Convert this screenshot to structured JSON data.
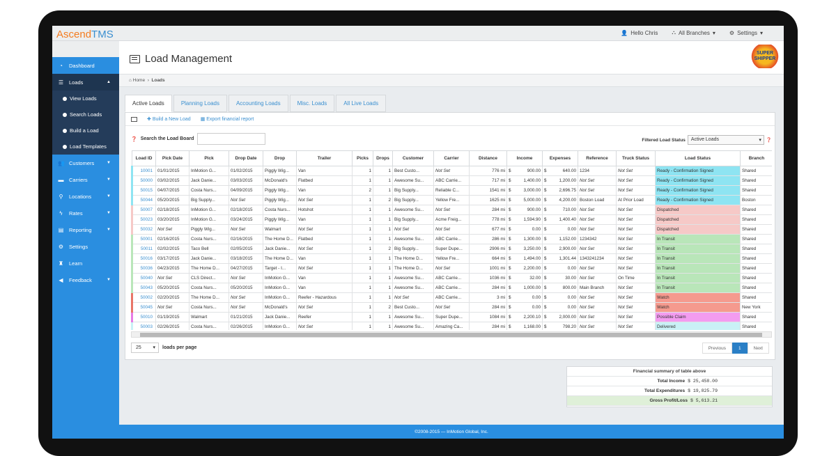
{
  "app": {
    "logo_a": "Ascend",
    "logo_b": "TMS"
  },
  "topnav": {
    "user": "Hello Chris",
    "branches": "All Branches",
    "settings": "Settings"
  },
  "sidebar": {
    "items": [
      {
        "label": "Dashboard",
        "icon": "dashboard-icon"
      },
      {
        "label": "Loads",
        "icon": "list-icon"
      },
      {
        "label": "Customers",
        "icon": "users-icon"
      },
      {
        "label": "Carriers",
        "icon": "truck-icon"
      },
      {
        "label": "Locations",
        "icon": "map-marker-icon"
      },
      {
        "label": "Rates",
        "icon": "bolt-icon"
      },
      {
        "label": "Reporting",
        "icon": "file-icon"
      },
      {
        "label": "Settings",
        "icon": "cogs-icon"
      },
      {
        "label": "Learn",
        "icon": "graduation-icon"
      },
      {
        "label": "Feedback",
        "icon": "bullhorn-icon"
      }
    ],
    "subitems": [
      "View Loads",
      "Search Loads",
      "Build a Load",
      "Load Templates"
    ]
  },
  "page": {
    "title": "Load Management",
    "breadcrumb_home": "Home",
    "breadcrumb_current": "Loads",
    "brand_logo": "SUPER SHIPPER"
  },
  "tabs": [
    "Active Loads",
    "Planning Loads",
    "Accounting Loads",
    "Misc. Loads",
    "All Live Loads"
  ],
  "toolbar": {
    "build": "Build a New Load",
    "export": "Export financial report"
  },
  "search": {
    "label": "Search the Load Board",
    "value": ""
  },
  "filter": {
    "label": "Filtered Load Status",
    "value": "Active Loads"
  },
  "table": {
    "headers": [
      "Load ID",
      "Pick Date",
      "Pick",
      "Drop Date",
      "Drop",
      "Trailer",
      "Picks",
      "Drops",
      "Customer",
      "Carrier",
      "Distance",
      "Income",
      "Expenses",
      "Reference",
      "Truck Status",
      "Load Status",
      "Branch"
    ],
    "rows": [
      [
        "10001",
        "01/01/2015",
        "InMotion G...",
        "01/02/2015",
        "Piggly Wig...",
        "Van",
        "1",
        "1",
        "Best Custo...",
        "Not Set",
        "776 mi",
        "900.00",
        "640.00",
        "1234",
        "Not Set",
        "Ready - Confirmation Signed",
        "Shared",
        "cyan"
      ],
      [
        "50000",
        "03/02/2015",
        "Jack Danie...",
        "03/03/2015",
        "McDonald's",
        "Flatbed",
        "1",
        "1",
        "Awesome Su...",
        "ABC Carrie...",
        "717 mi",
        "1,400.00",
        "1,200.00",
        "Not Set",
        "Not Set",
        "Ready - Confirmation Signed",
        "Shared",
        "cyan"
      ],
      [
        "50015",
        "04/07/2015",
        "Costa Nurs...",
        "04/09/2015",
        "Piggly Wig...",
        "Van",
        "2",
        "1",
        "Big Supply...",
        "Reliable C...",
        "1541 mi",
        "3,000.00",
        "2,696.75",
        "Not Set",
        "Not Set",
        "Ready - Confirmation Signed",
        "Shared",
        "cyan"
      ],
      [
        "50044",
        "05/20/2015",
        "Big Supply...",
        "Not Set",
        "Piggly Wig...",
        "Not Set",
        "1",
        "2",
        "Big Supply...",
        "Yellow Fre...",
        "1625 mi",
        "5,000.00",
        "4,200.00",
        "Boston Load",
        "At Prior Load",
        "Ready - Confirmation Signed",
        "Boston",
        "cyan"
      ],
      [
        "50007",
        "02/18/2015",
        "InMotion G...",
        "02/18/2015",
        "Costa Nurs...",
        "Hotshot",
        "1",
        "1",
        "Awesome Su...",
        "Not Set",
        "284 mi",
        "900.00",
        "710.00",
        "Not Set",
        "Not Set",
        "Dispatched",
        "Shared",
        "pink"
      ],
      [
        "50023",
        "03/20/2015",
        "InMotion G...",
        "03/24/2015",
        "Piggly Wig...",
        "Van",
        "1",
        "1",
        "Big Supply...",
        "Acme Freig...",
        "778 mi",
        "1,594.90",
        "1,400.40",
        "Not Set",
        "Not Set",
        "Dispatched",
        "Shared",
        "pink"
      ],
      [
        "50032",
        "Not Set",
        "Piggly Wig...",
        "Not Set",
        "Walmart",
        "Not Set",
        "1",
        "1",
        "Not Set",
        "Not Set",
        "677 mi",
        "0.00",
        "0.00",
        "Not Set",
        "Not Set",
        "Dispatched",
        "Shared",
        "pink"
      ],
      [
        "50001",
        "02/16/2015",
        "Costa Nurs...",
        "02/16/2015",
        "The Home D...",
        "Flatbed",
        "1",
        "1",
        "Awesome Su...",
        "ABC Carrie...",
        "286 mi",
        "1,300.00",
        "1,152.00",
        "1234342",
        "Not Set",
        "In Transit",
        "Shared",
        "green"
      ],
      [
        "50011",
        "02/02/2015",
        "Taco Bell",
        "02/05/2015",
        "Jack Danie...",
        "Not Set",
        "1",
        "2",
        "Big Supply...",
        "Super Dupe...",
        "2906 mi",
        "3,250.00",
        "2,900.00",
        "Not Set",
        "Not Set",
        "In Transit",
        "Shared",
        "green"
      ],
      [
        "50016",
        "03/17/2015",
        "Jack Danie...",
        "03/18/2015",
        "The Home D...",
        "Van",
        "1",
        "1",
        "The Home D...",
        "Yellow Fre...",
        "664 mi",
        "1,494.00",
        "1,301.44",
        "1343241234",
        "Not Set",
        "In Transit",
        "Shared",
        "green"
      ],
      [
        "50036",
        "04/23/2015",
        "The Home D...",
        "04/27/2015",
        "Target - I...",
        "Not Set",
        "1",
        "1",
        "The Home D...",
        "Not Set",
        "1001 mi",
        "2,200.00",
        "0.00",
        "Not Set",
        "Not Set",
        "In Transit",
        "Shared",
        "green"
      ],
      [
        "50040",
        "Not Set",
        "CLS Direct...",
        "Not Set",
        "InMotion G...",
        "Van",
        "1",
        "1",
        "Awesome Su...",
        "ABC Carrie...",
        "1036 mi",
        "32.00",
        "30.00",
        "Not Set",
        "On Time",
        "In Transit",
        "Shared",
        "green"
      ],
      [
        "50043",
        "05/20/2015",
        "Costa Nurs...",
        "05/20/2015",
        "InMotion G...",
        "Van",
        "1",
        "1",
        "Awesome Su...",
        "ABC Carrie...",
        "284 mi",
        "1,000.00",
        "800.00",
        "Main Branch",
        "Not Set",
        "In Transit",
        "Shared",
        "green"
      ],
      [
        "50002",
        "02/20/2015",
        "The Home D...",
        "Not Set",
        "InMotion G...",
        "Reefer - Hazardous",
        "1",
        "1",
        "Not Set",
        "ABC Carrie...",
        "3 mi",
        "0.00",
        "0.00",
        "Not Set",
        "Not Set",
        "Watch",
        "Shared",
        "red"
      ],
      [
        "50045",
        "Not Set",
        "Costa Nurs...",
        "Not Set",
        "McDonald's",
        "Not Set",
        "1",
        "2",
        "Best Custo...",
        "Not Set",
        "284 mi",
        "0.00",
        "0.00",
        "Not Set",
        "Not Set",
        "Watch",
        "New York",
        "red"
      ],
      [
        "50010",
        "01/19/2015",
        "Walmart",
        "01/21/2015",
        "Jack Danie...",
        "Reefer",
        "1",
        "1",
        "Awesome Su...",
        "Super Dupe...",
        "1084 mi",
        "2,200.10",
        "2,000.00",
        "Not Set",
        "Not Set",
        "Possible Claim",
        "Shared",
        "mag"
      ],
      [
        "50003",
        "02/26/2015",
        "Costa Nurs...",
        "02/26/2015",
        "InMotion G...",
        "Not Set",
        "1",
        "1",
        "Awesome Su...",
        "Amazing Ca...",
        "284 mi",
        "1,168.00",
        "798.20",
        "Not Set",
        "Not Set",
        "Delivered",
        "Shared",
        "lcyan"
      ]
    ]
  },
  "pager": {
    "per_page": "25",
    "per_page_label": "loads per page",
    "previous": "Previous",
    "current": "1",
    "next": "Next"
  },
  "financial": {
    "title": "Financial summary of table above",
    "income_label": "Total Income",
    "income": "$ 25,458.00",
    "expend_label": "Total Expenditures",
    "expend": "$ 19,825.79",
    "profit_label": "Gross Profit/Loss",
    "profit": "$ 5,613.21"
  },
  "footer": "©2008-2015 — InMotion Global, Inc.",
  "colors": {
    "accent": "#2a8ee0",
    "sidebar_active": "#1e3550",
    "logo_orange": "#f47c20"
  }
}
